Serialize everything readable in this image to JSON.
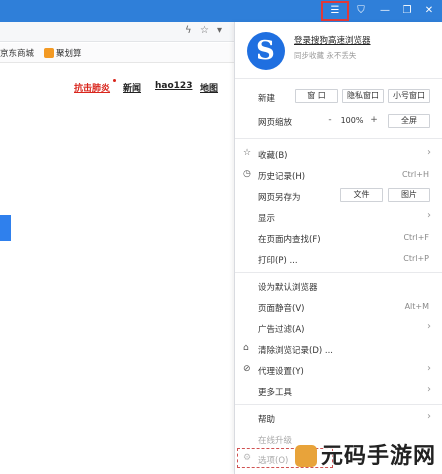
{
  "titlebar": {
    "menu_icon": "hamburger-icon",
    "skin_icon": "shirt-icon",
    "minimize": "—",
    "restore": "❐",
    "close": "✕"
  },
  "addrbar": {
    "flash": "ϟ",
    "star": "☆",
    "dropdown": "▾"
  },
  "bookmarks": {
    "items": [
      "京东商城",
      "聚划算"
    ]
  },
  "page": {
    "nav": [
      "抗击肺炎",
      "新闻",
      "hao123",
      "地图"
    ]
  },
  "menu": {
    "login_link": "登录搜狗高速浏览器",
    "login_sub": "同步收藏 永不丢失",
    "new_label": "新建",
    "new_window": "窗 口",
    "private_window": "隐私窗口",
    "small_window": "小号窗口",
    "zoom_label": "网页缩放",
    "zoom_minus": "-",
    "zoom_value": "100%",
    "zoom_plus": "+",
    "fullscreen": "全屏",
    "items": [
      {
        "label": "收藏(B)",
        "icon": "☆",
        "shortcut": "",
        "arrow": "›"
      },
      {
        "label": "历史记录(H)",
        "icon": "◷",
        "shortcut": "Ctrl+H",
        "arrow": ""
      },
      {
        "label": "网页另存为",
        "icon": "",
        "shortcut": "",
        "arrow": ""
      },
      {
        "label": "显示",
        "icon": "",
        "shortcut": "",
        "arrow": "›"
      },
      {
        "label": "在页面内查找(F)",
        "icon": "",
        "shortcut": "Ctrl+F",
        "arrow": ""
      },
      {
        "label": "打印(P) ...",
        "icon": "",
        "shortcut": "Ctrl+P",
        "arrow": ""
      },
      {
        "label": "设为默认浏览器",
        "icon": "",
        "shortcut": "",
        "arrow": ""
      },
      {
        "label": "页面静音(V)",
        "icon": "",
        "shortcut": "Alt+M",
        "arrow": ""
      },
      {
        "label": "广告过滤(A)",
        "icon": "",
        "shortcut": "",
        "arrow": "›"
      },
      {
        "label": "清除浏览记录(D) ...",
        "icon": "⌂",
        "shortcut": "",
        "arrow": ""
      },
      {
        "label": "代理设置(Y)",
        "icon": "⊘",
        "shortcut": "",
        "arrow": "›"
      },
      {
        "label": "更多工具",
        "icon": "",
        "shortcut": "",
        "arrow": "›"
      },
      {
        "label": "帮助",
        "icon": "",
        "shortcut": "",
        "arrow": "›"
      },
      {
        "label": "在线升级",
        "icon": "",
        "shortcut": "",
        "arrow": ""
      },
      {
        "label": "选项(O)",
        "icon": "⚙",
        "shortcut": "",
        "arrow": ""
      }
    ],
    "saveas_file": "文件",
    "saveas_image": "图片"
  },
  "watermark": "元码手游网",
  "colors": {
    "titlebar": "#2f7fd9",
    "accent_red": "#d9251c",
    "logo_blue": "#1f6fe0"
  }
}
